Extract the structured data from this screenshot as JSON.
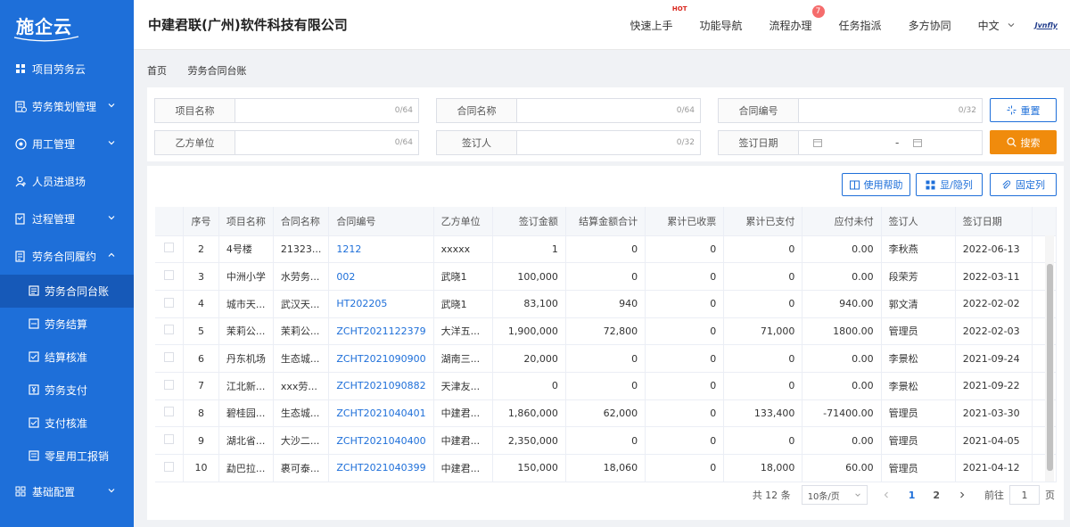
{
  "app": {
    "logo": "施企云",
    "company": "中建君联(广州)软件科技有限公司"
  },
  "header": {
    "nav": [
      {
        "label": "快速上手",
        "tag": "HOT"
      },
      {
        "label": "功能导航"
      },
      {
        "label": "流程办理",
        "badge": "7"
      },
      {
        "label": "任务指派"
      },
      {
        "label": "多方协同"
      }
    ],
    "language": "中文",
    "brand": "Jvnfly"
  },
  "sidebar": {
    "items": [
      {
        "label": "项目劳务云",
        "icon": "grid-icon"
      },
      {
        "label": "劳务策划管理",
        "icon": "plan-icon"
      },
      {
        "label": "用工管理",
        "icon": "worker-icon"
      },
      {
        "label": "人员进退场",
        "icon": "user-icon"
      },
      {
        "label": "过程管理",
        "icon": "process-icon"
      },
      {
        "label": "劳务合同履约",
        "icon": "contract-icon"
      }
    ],
    "sub_items": [
      {
        "label": "劳务合同台账",
        "active": true
      },
      {
        "label": "劳务结算"
      },
      {
        "label": "结算核准"
      },
      {
        "label": "劳务支付"
      },
      {
        "label": "支付核准"
      },
      {
        "label": "零星用工报销"
      }
    ],
    "footer_item": {
      "label": "基础配置"
    }
  },
  "breadcrumb": [
    "首页",
    "劳务合同台账"
  ],
  "filters": [
    {
      "label": "项目名称",
      "count": "0/64"
    },
    {
      "label": "合同名称",
      "count": "0/64"
    },
    {
      "label": "合同编号",
      "count": "0/32"
    },
    {
      "label": "乙方单位",
      "count": "0/64"
    },
    {
      "label": "签订人",
      "count": "0/32"
    },
    {
      "label": "签订日期",
      "separator": "-"
    }
  ],
  "buttons": {
    "reset": "重置",
    "search": "搜索",
    "help": "使用帮助",
    "toggle_columns": "显/隐列",
    "fix_columns": "固定列"
  },
  "table": {
    "headers": [
      "序号",
      "项目名称",
      "合同名称",
      "合同编号",
      "乙方单位",
      "签订金额",
      "结算金额合计",
      "累计已收票",
      "累计已支付",
      "应付未付",
      "签订人",
      "签订日期"
    ],
    "rows": [
      [
        "2",
        "4号楼",
        "21323...",
        "1212",
        "xxxxx",
        "1",
        "0",
        "0",
        "0",
        "0.00",
        "李秋燕",
        "2022-06-13"
      ],
      [
        "3",
        "中洲小学",
        "水劳务...",
        "002",
        "武晓1",
        "100,000",
        "0",
        "0",
        "0",
        "0.00",
        "段荣芳",
        "2022-03-11"
      ],
      [
        "4",
        "城市天...",
        "武汉天...",
        "HT202205",
        "武晓1",
        "83,100",
        "940",
        "0",
        "0",
        "940.00",
        "郭文清",
        "2022-02-02"
      ],
      [
        "5",
        "茉莉公...",
        "茉莉公...",
        "ZCHT2021122379",
        "大洋五...",
        "1,900,000",
        "72,800",
        "0",
        "71,000",
        "1800.00",
        "管理员",
        "2022-02-03"
      ],
      [
        "6",
        "丹东机场",
        "生态城...",
        "ZCHT2021090900",
        "湖南三...",
        "20,000",
        "0",
        "0",
        "0",
        "0.00",
        "李景松",
        "2021-09-24"
      ],
      [
        "7",
        "江北新...",
        "xxx劳...",
        "ZCHT2021090882",
        "天津友...",
        "0",
        "0",
        "0",
        "0",
        "0.00",
        "李景松",
        "2021-09-22"
      ],
      [
        "8",
        "碧桂园...",
        "生态城...",
        "ZCHT2021040401",
        "中建君...",
        "1,860,000",
        "62,000",
        "0",
        "133,400",
        "-71400.00",
        "管理员",
        "2021-03-30"
      ],
      [
        "9",
        "湖北省...",
        "大沙二...",
        "ZCHT2021040400",
        "中建君...",
        "2,350,000",
        "0",
        "0",
        "0",
        "0.00",
        "管理员",
        "2021-04-05"
      ],
      [
        "10",
        "勐巴拉...",
        "裹可泰...",
        "ZCHT2021040399",
        "中建君...",
        "150,000",
        "18,060",
        "0",
        "18,000",
        "60.00",
        "管理员",
        "2021-04-12"
      ]
    ]
  },
  "pagination": {
    "total": "共 12 条",
    "page_size": "10条/页",
    "pages": [
      "1",
      "2"
    ],
    "current": "1",
    "goto_prefix": "前往",
    "goto_value": "1",
    "goto_suffix": "页"
  }
}
